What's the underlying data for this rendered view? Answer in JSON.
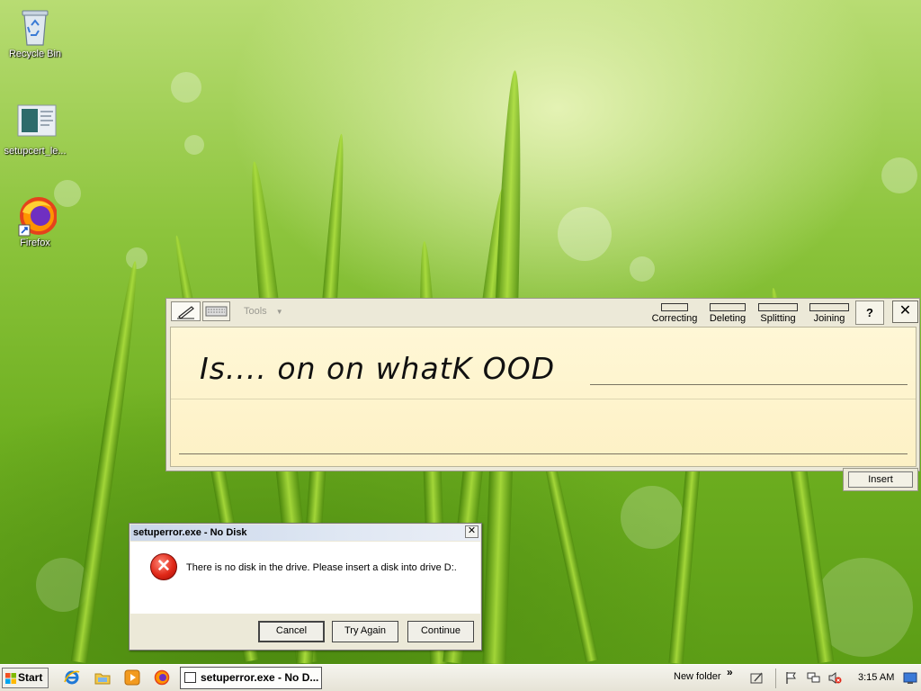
{
  "desktop": {
    "icons": [
      {
        "label": "Recycle Bin",
        "icon": "recycle-bin-icon"
      },
      {
        "label": "setupcert_le...",
        "icon": "certificate-file-icon"
      },
      {
        "label": "Firefox",
        "icon": "firefox-icon"
      }
    ]
  },
  "tip": {
    "tools_label": "Tools",
    "buttons": {
      "correcting": "Correcting",
      "deleting": "Deleting",
      "splitting": "Splitting",
      "joining": "Joining"
    },
    "help_label": "?",
    "close_label": "✕",
    "ink_text": "Is.... on on whatK OOD",
    "insert_label": "Insert"
  },
  "dialog": {
    "title": "setuperror.exe - No Disk",
    "close_label": "✕",
    "message": "There is no disk in the drive. Please insert a disk into drive D:.",
    "buttons": {
      "cancel": "Cancel",
      "try_again": "Try Again",
      "continue": "Continue"
    }
  },
  "taskbar": {
    "start_label": "Start",
    "task_button": "setuperror.exe - No D...",
    "toolbar_label": "New folder",
    "chevron": "»",
    "clock": "3:15 AM"
  },
  "colors": {
    "wallpaper_green": "#8cc43c",
    "pad_yellow": "#fff7d6",
    "error_red": "#e02818",
    "dialog_face": "#ece9d8"
  }
}
